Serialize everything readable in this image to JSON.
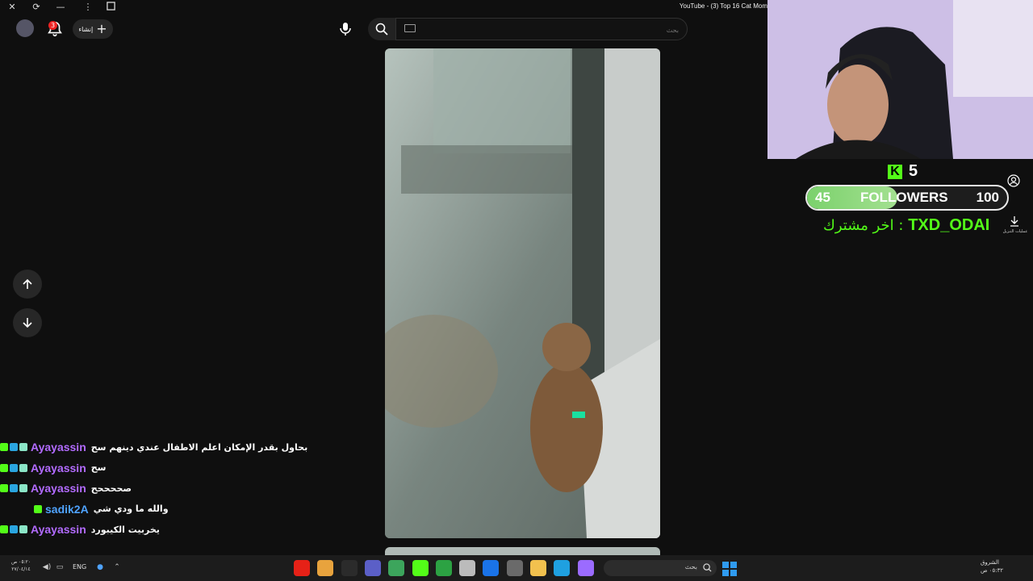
{
  "window": {
    "title": "YouTube - (3) Top 16 Cat Mom",
    "close_glyph": "✕",
    "reload_glyph": "⟳",
    "minimize_glyph": "—",
    "menu_glyph": "⋮"
  },
  "header": {
    "notifications_count": "3",
    "create_label": "إنشاء",
    "create_plus": "+",
    "search_placeholder": "بحث"
  },
  "stream_overlay": {
    "kick_badge": "K",
    "kick_count": "5",
    "goal": {
      "current": "45",
      "label": "FOLLOWERS",
      "target": "100",
      "progress": 0.45
    },
    "last_sub_label": "اخر مشترك :",
    "last_sub_name": "TXD_ODAI",
    "downloads_label": "عمليات التنزيل"
  },
  "chat": [
    {
      "user": "Ayayassin",
      "color": "#b26bff",
      "badges": [
        "kick",
        "blue",
        "sub"
      ],
      "message": "بحاول بقدر الإمكان اعلم الاطفال عندي دينهم سح"
    },
    {
      "user": "Ayayassin",
      "color": "#b26bff",
      "badges": [
        "kick",
        "blue",
        "sub"
      ],
      "message": "سح"
    },
    {
      "user": "Ayayassin",
      "color": "#b26bff",
      "badges": [
        "kick",
        "blue",
        "sub"
      ],
      "message": "صححححح"
    },
    {
      "user": "sadik2A",
      "color": "#4fa3ff",
      "badges": [
        "kick"
      ],
      "message": "والله ما ودي شي"
    },
    {
      "user": "Ayayassin",
      "color": "#b26bff",
      "badges": [
        "kick",
        "blue",
        "sub"
      ],
      "message": "يخربيت الكيبورد"
    }
  ],
  "taskbar": {
    "clock_time": "٠٥:٢٠ ص",
    "clock_date": "٢٧/٠٤/١٤",
    "language": "ENG",
    "search_label": "بحث",
    "weather_text": "الشروق",
    "weather_time": "٠٥:٣٢ ص",
    "apps": [
      {
        "name": "youtube-app",
        "color": "#e62117"
      },
      {
        "name": "chrome-app",
        "color": "#e8a33d"
      },
      {
        "name": "obs-app",
        "color": "#2b2b2b"
      },
      {
        "name": "teams-app",
        "color": "#5b5fc7"
      },
      {
        "name": "chrome-app-2",
        "color": "#3ca55c"
      },
      {
        "name": "kick-app",
        "color": "#53fc18"
      },
      {
        "name": "xbox-app",
        "color": "#2ca243"
      },
      {
        "name": "widgets-app",
        "color": "#bbbbbb"
      },
      {
        "name": "outlook-app",
        "color": "#1a73e8"
      },
      {
        "name": "store-app",
        "color": "#6a6a6a"
      },
      {
        "name": "explorer-app",
        "color": "#f2c14e"
      },
      {
        "name": "edge-app",
        "color": "#1fa0e0"
      },
      {
        "name": "copilot-app",
        "color": "#9b6bff"
      }
    ]
  }
}
